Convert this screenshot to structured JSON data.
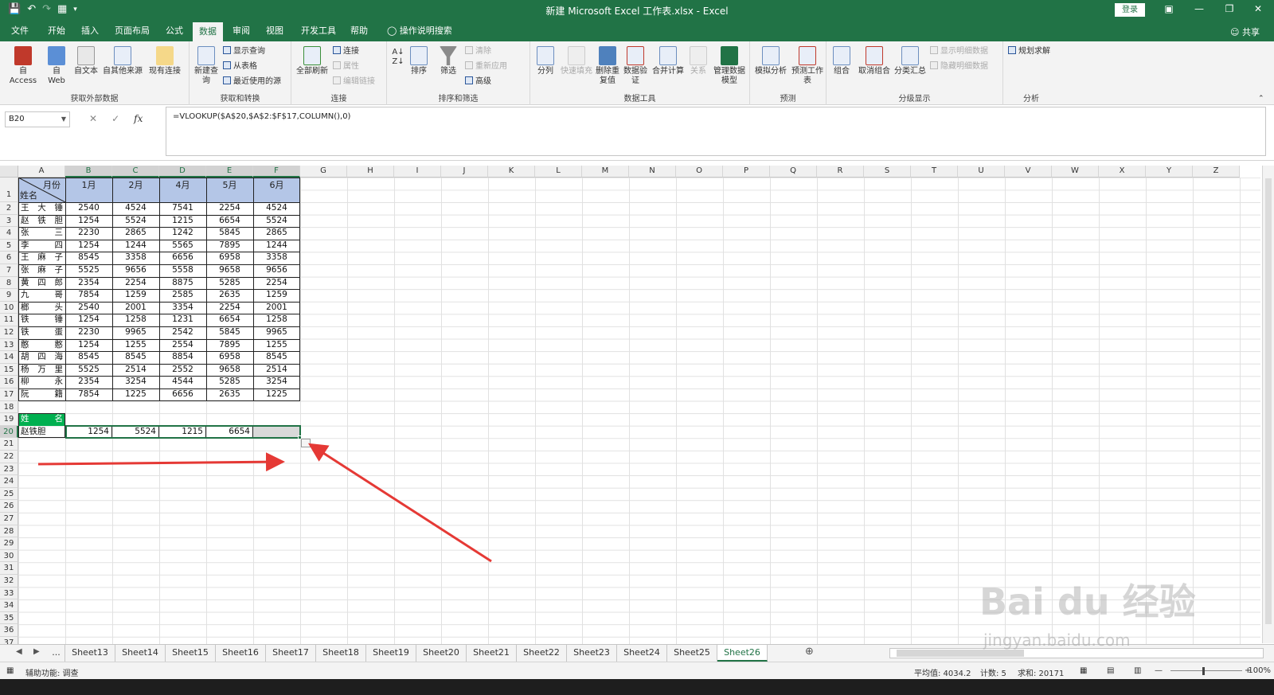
{
  "window": {
    "title": "新建 Microsoft Excel 工作表.xlsx  -  Excel",
    "login": "登录",
    "share": "共享"
  },
  "menu_tabs": [
    "文件",
    "开始",
    "插入",
    "页面布局",
    "公式",
    "数据",
    "审阅",
    "视图",
    "开发工具",
    "帮助",
    "操作说明搜索"
  ],
  "active_tab": "数据",
  "ribbon": {
    "groups": [
      {
        "label": "获取外部数据",
        "buttons": [
          "自 Access",
          "自 Web",
          "自文本",
          "自其他来源",
          "现有连接"
        ]
      },
      {
        "label": "获取和转换",
        "buttons": [
          "新建查询",
          "显示查询",
          "从表格",
          "最近使用的源"
        ]
      },
      {
        "label": "连接",
        "buttons": [
          "全部刷新",
          "连接",
          "属性",
          "编辑链接"
        ]
      },
      {
        "label": "排序和筛选",
        "buttons": [
          "排序",
          "筛选",
          "清除",
          "重新应用",
          "高级"
        ]
      },
      {
        "label": "数据工具",
        "buttons": [
          "分列",
          "快速填充",
          "删除重复值",
          "数据验证",
          "合并计算",
          "关系",
          "管理数据模型"
        ]
      },
      {
        "label": "预测",
        "buttons": [
          "模拟分析",
          "预测工作表"
        ]
      },
      {
        "label": "分级显示",
        "buttons": [
          "组合",
          "取消组合",
          "分类汇总",
          "显示明细数据",
          "隐藏明细数据"
        ]
      },
      {
        "label": "分析",
        "buttons": [
          "规划求解"
        ]
      }
    ]
  },
  "formula_bar": {
    "name_box": "B20",
    "formula": "=VLOOKUP($A$20,$A$2:$F$17,COLUMN(),0)"
  },
  "columns": [
    "A",
    "B",
    "C",
    "D",
    "E",
    "F",
    "G",
    "H",
    "I",
    "J",
    "K",
    "L",
    "M",
    "N",
    "O",
    "P",
    "Q",
    "R",
    "S",
    "T",
    "U",
    "V",
    "W",
    "X",
    "Y",
    "Z"
  ],
  "rows": [
    "1",
    "2",
    "3",
    "4",
    "5",
    "6",
    "7",
    "8",
    "9",
    "10",
    "11",
    "12",
    "13",
    "14",
    "15",
    "16",
    "17",
    "18",
    "19",
    "20",
    "21",
    "22",
    "23",
    "24",
    "25",
    "26",
    "27",
    "28",
    "29",
    "30",
    "31",
    "32",
    "33",
    "34",
    "35",
    "36",
    "37"
  ],
  "table": {
    "corner_top": "月份",
    "corner_bottom": "姓名",
    "months": [
      "1月",
      "2月",
      "4月",
      "5月",
      "6月"
    ],
    "names": [
      "王 大 锤",
      "赵 铁 胆",
      "张   三",
      "李   四",
      "王 麻 子",
      "张 麻 子",
      "黄 四 郎",
      "九   哥",
      "榔   头",
      "铁   锤",
      "铁   蛋",
      "憨   憨",
      "胡 四 海",
      "杨 万 里",
      "柳   永",
      "阮   籍"
    ],
    "values": [
      [
        2540,
        4524,
        7541,
        2254,
        4524
      ],
      [
        1254,
        5524,
        1215,
        6654,
        5524
      ],
      [
        2230,
        2865,
        1242,
        5845,
        2865
      ],
      [
        1254,
        1244,
        5565,
        7895,
        1244
      ],
      [
        8545,
        3358,
        6656,
        6958,
        3358
      ],
      [
        5525,
        9656,
        5558,
        9658,
        9656
      ],
      [
        2354,
        2254,
        8875,
        5285,
        2254
      ],
      [
        7854,
        1259,
        2585,
        2635,
        1259
      ],
      [
        2540,
        2001,
        3354,
        2254,
        2001
      ],
      [
        1254,
        1258,
        1231,
        6654,
        1258
      ],
      [
        2230,
        9965,
        2542,
        5845,
        9965
      ],
      [
        1254,
        1255,
        2554,
        7895,
        1255
      ],
      [
        8545,
        8545,
        8854,
        6958,
        8545
      ],
      [
        5525,
        2514,
        2552,
        9658,
        2514
      ],
      [
        2354,
        3254,
        4544,
        5285,
        3254
      ],
      [
        7854,
        1225,
        6656,
        2635,
        1225
      ]
    ]
  },
  "lookup": {
    "header": "姓      名",
    "name": "赵铁胆",
    "results": [
      "1254",
      "5524",
      "1215",
      "6654"
    ]
  },
  "sheet_tabs": [
    "...",
    "Sheet13",
    "Sheet14",
    "Sheet15",
    "Sheet16",
    "Sheet17",
    "Sheet18",
    "Sheet19",
    "Sheet20",
    "Sheet21",
    "Sheet22",
    "Sheet23",
    "Sheet24",
    "Sheet25",
    "Sheet26"
  ],
  "active_sheet": "Sheet26",
  "status": {
    "mode": "辅助功能: 调查",
    "average": "平均值: 4034.2",
    "count": "计数: 5",
    "sum": "求和: 20171",
    "zoom": "100%"
  },
  "watermark": {
    "main": "Bai du 经验",
    "sub": "jingyan.baidu.com"
  },
  "colors": {
    "excel_green": "#217346",
    "header_fill": "#b4c6e7",
    "lookup_header_fill": "#00b050",
    "arrow": "#e53935"
  }
}
